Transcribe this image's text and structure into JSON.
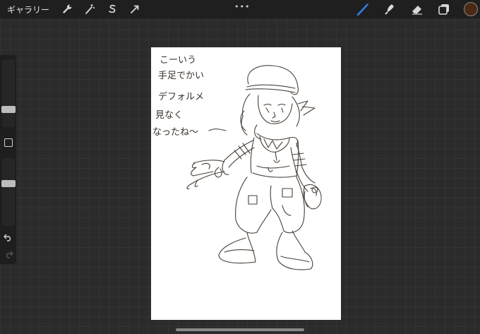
{
  "topbar": {
    "gallery_label": "ギャラリー",
    "actions_icon": "wrench-icon",
    "adjustments_icon": "magic-wand-icon",
    "selection_icon": "selection-s-icon",
    "transform_icon": "arrow-cursor-icon",
    "more_label": "•••",
    "brush_icon": "brush-icon",
    "smudge_icon": "smudge-icon",
    "eraser_icon": "eraser-icon",
    "layers_icon": "layers-icon",
    "current_color": "#4a2a14",
    "brush_color": "#2f7de1"
  },
  "sidebar": {
    "brush_size_icon": "size-slider",
    "opacity_icon": "opacity-slider",
    "modify_icon": "square-modify-icon",
    "undo_icon": "undo-icon",
    "redo_icon": "redo-icon"
  },
  "canvas": {
    "handwritten_note": [
      "こーいう",
      "手足でかい",
      "デフォルメ",
      "見なく",
      "なったね〜"
    ]
  }
}
